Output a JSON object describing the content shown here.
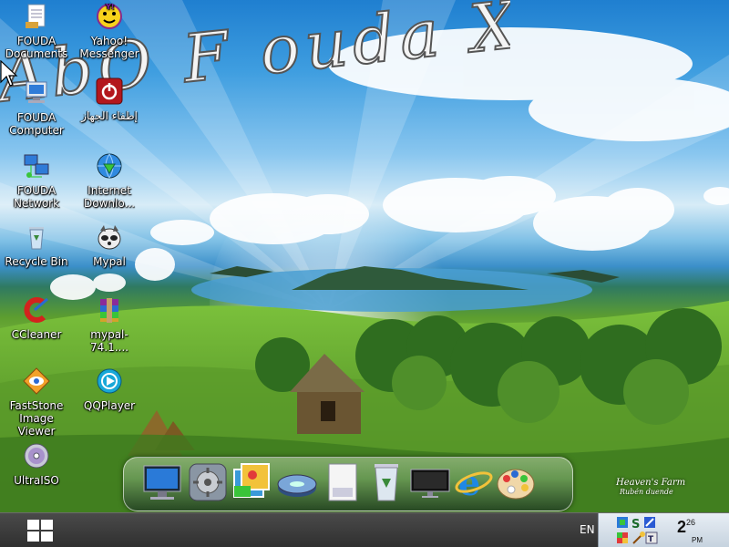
{
  "wallpaper": {
    "title": "AbO F ouda X p",
    "signature": "Heaven's Farm",
    "signature_sub": "Rubén duende"
  },
  "desktop_icons": [
    {
      "label": "FOUDA",
      "label2": "Documents",
      "icon": "documents-icon"
    },
    {
      "label": "Yahoo!",
      "label2": "Messenger",
      "icon": "yahoo-messenger-icon"
    },
    {
      "label": "FOUDA",
      "label2": "Computer",
      "icon": "computer-icon"
    },
    {
      "label": "إطفاء الجهاز",
      "label2": "",
      "icon": "shutdown-icon"
    },
    {
      "label": "FOUDA",
      "label2": "Network",
      "icon": "network-icon"
    },
    {
      "label": "Internet",
      "label2": "Downlo...",
      "icon": "internet-download-manager-icon"
    },
    {
      "label": "Recycle Bin",
      "label2": "",
      "icon": "recycle-bin-icon"
    },
    {
      "label": "Mypal",
      "label2": "",
      "icon": "mypal-icon"
    },
    {
      "label": "CCleaner",
      "label2": "",
      "icon": "ccleaner-icon"
    },
    {
      "label": "mypal-74.1....",
      "label2": "",
      "icon": "winrar-archive-icon"
    },
    {
      "label": "FastStone",
      "label2": "Image Viewer",
      "icon": "faststone-icon"
    },
    {
      "label": "QQPlayer",
      "label2": "",
      "icon": "qqplayer-icon"
    },
    {
      "label": "UltraISO",
      "label2": "",
      "icon": "ultraiso-icon"
    }
  ],
  "dock": {
    "items": [
      "monitor-icon",
      "settings-icon",
      "photos-icon",
      "drive-icon",
      "document-icon",
      "trash-icon",
      "display-icon",
      "internet-explorer-icon",
      "paint-palette-icon"
    ]
  },
  "taskbar": {
    "language": "EN",
    "clock_hour": "2",
    "clock_minute": "26",
    "clock_ampm": "PM",
    "tray_icons": [
      "network-tray-icon",
      "sync-tray-icon",
      "tools-tray-icon",
      "flag-tray-icon",
      "wand-tray-icon"
    ]
  },
  "colors": {
    "taskbar": "#3a3a3a",
    "tray": "#d6e0ea",
    "icon_text": "#ffffff"
  }
}
